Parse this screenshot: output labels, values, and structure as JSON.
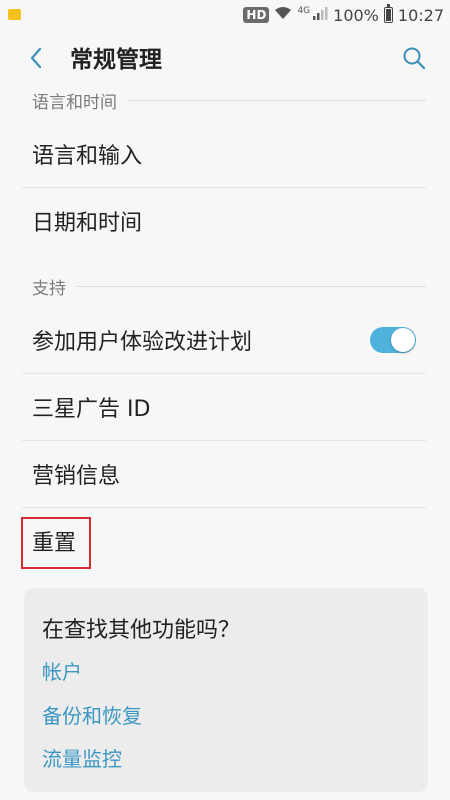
{
  "status_bar": {
    "hd_badge": "HD",
    "network_type": "4G",
    "battery_percent": "100%",
    "time": "10:27"
  },
  "app_bar": {
    "title": "常规管理"
  },
  "sections": {
    "language_time": {
      "header": "语言和时间",
      "items": [
        "语言和输入",
        "日期和时间"
      ]
    },
    "support": {
      "header": "支持",
      "items": [
        "参加用户体验改进计划",
        "三星广告 ID",
        "营销信息",
        "重置"
      ]
    }
  },
  "toggle_ux_program": {
    "enabled": true
  },
  "suggestion_card": {
    "title": "在查找其他功能吗？",
    "links": [
      "帐户",
      "备份和恢复",
      "流量监控"
    ]
  },
  "colors": {
    "accent": "#4fb2dc",
    "link": "#3b97c2",
    "highlight_border": "#d72c33"
  }
}
